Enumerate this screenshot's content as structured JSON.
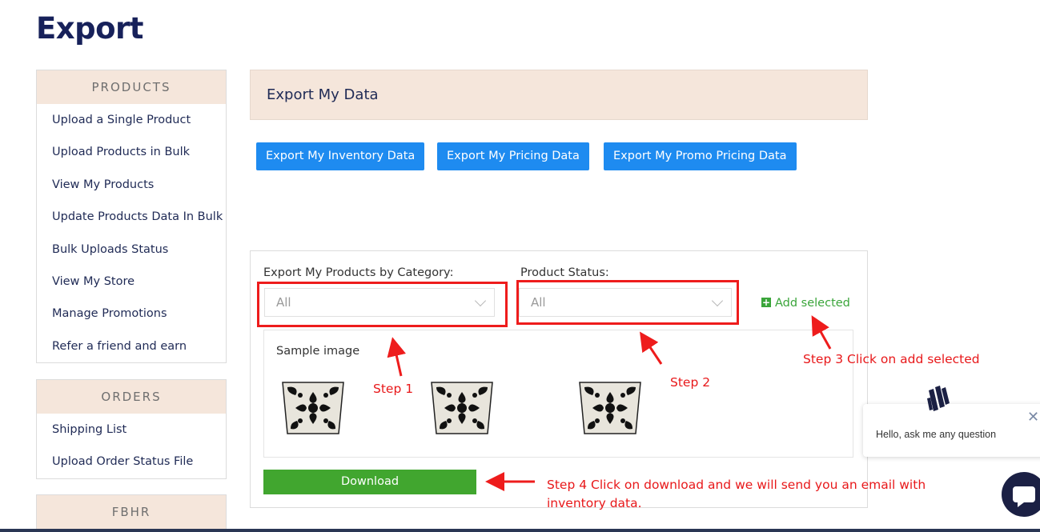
{
  "page": {
    "title": "Export"
  },
  "sidebar": {
    "sections": [
      {
        "header": "PRODUCTS",
        "items": [
          {
            "label": "Upload a Single Product"
          },
          {
            "label": "Upload Products in Bulk"
          },
          {
            "label": "View My Products"
          },
          {
            "label": "Update Products Data In Bulk"
          },
          {
            "label": "Bulk Uploads Status"
          },
          {
            "label": "View My Store"
          },
          {
            "label": "Manage Promotions"
          },
          {
            "label": "Refer a friend and earn"
          }
        ]
      },
      {
        "header": "ORDERS",
        "items": [
          {
            "label": "Shipping List"
          },
          {
            "label": "Upload Order Status File"
          }
        ]
      },
      {
        "header": "FBHR",
        "items": []
      }
    ]
  },
  "export_data": {
    "title": "Export My Data",
    "buttons": {
      "inventory": "Export My Inventory Data",
      "pricing": "Export My Pricing Data",
      "promo": "Export My Promo Pricing Data"
    }
  },
  "category_export": {
    "category_label": "Export My Products by Category:",
    "category_value": "All",
    "status_label": "Product Status:",
    "status_value": "All",
    "add_selected": "Add selected",
    "sample_label": "Sample image",
    "download": "Download"
  },
  "annotations": {
    "step1": "Step 1",
    "step2": "Step 2",
    "step3": "Step 3 Click on add selected",
    "step4_line1": "Step 4 Click on download and we will send you an email with",
    "step4_line2": "inventory data."
  },
  "chat": {
    "message": "Hello, ask me any question"
  },
  "icons": [
    "plus-square-icon",
    "close-icon",
    "chat-icon",
    "chevron-down-icon"
  ],
  "colors": {
    "primary_blue": "#1e8bf0",
    "download_green": "#41a62f",
    "annotation_red": "#ee1c1c",
    "header_beige": "#f5e6db",
    "title_navy": "#17215a"
  }
}
